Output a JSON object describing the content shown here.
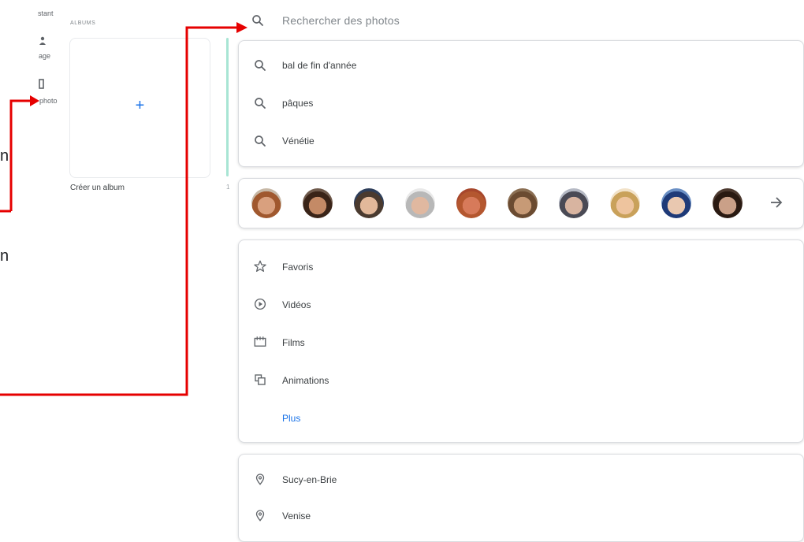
{
  "sidebar": {
    "items": [
      {
        "label": "stant",
        "icon": "assistant-icon"
      },
      {
        "label": "age",
        "icon": "sharing-icon"
      },
      {
        "label": "photo",
        "icon": "photo-book-icon"
      }
    ],
    "albums_heading": "ALBUMS",
    "create_album_label": "Créer un album",
    "create_album_icon": "+",
    "stray_text": "1",
    "edge_letter_1": "n",
    "edge_letter_2": "n"
  },
  "search": {
    "placeholder": "Rechercher des photos",
    "suggestions": [
      {
        "label": "bal de fin d'année"
      },
      {
        "label": "pâques"
      },
      {
        "label": "Vénétie"
      }
    ]
  },
  "people": {
    "faces": [
      {
        "skin": "#d9a07e",
        "hair": "#a0582e",
        "bg": "#c7b8a6"
      },
      {
        "skin": "#c48a66",
        "hair": "#3a2418",
        "bg": "#6f5a4c"
      },
      {
        "skin": "#e2b89a",
        "hair": "#4a3a2f",
        "bg": "#2e3e5a"
      },
      {
        "skin": "#e0b8a0",
        "hair": "#b8b8b8",
        "bg": "#e9e9e9"
      },
      {
        "skin": "#d77a5a",
        "hair": "#b4572f",
        "bg": "#a7472c"
      },
      {
        "skin": "#c79a76",
        "hair": "#6b4b31",
        "bg": "#8a6e52"
      },
      {
        "skin": "#d8b4a0",
        "hair": "#4a4a55",
        "bg": "#b5b9c4"
      },
      {
        "skin": "#eec49e",
        "hair": "#c9a15a",
        "bg": "#f2e2c8"
      },
      {
        "skin": "#e9c8b0",
        "hair": "#1e3a78",
        "bg": "#6a8fc4"
      },
      {
        "skin": "#caa088",
        "hair": "#2a1a12",
        "bg": "#4d3a30"
      }
    ],
    "more_icon": "arrow-right-icon"
  },
  "categories": {
    "items": [
      {
        "label": "Favoris",
        "icon": "star-outline-icon"
      },
      {
        "label": "Vidéos",
        "icon": "play-circle-icon"
      },
      {
        "label": "Films",
        "icon": "movie-icon"
      },
      {
        "label": "Animations",
        "icon": "animation-icon"
      }
    ],
    "more_label": "Plus"
  },
  "places": {
    "items": [
      {
        "label": "Sucy-en-Brie",
        "icon": "location-pin-icon"
      },
      {
        "label": "Venise",
        "icon": "location-pin-icon"
      }
    ]
  },
  "colors": {
    "accent": "#1a73e8",
    "annotation": "#e60000",
    "icon": "#5f6368"
  }
}
